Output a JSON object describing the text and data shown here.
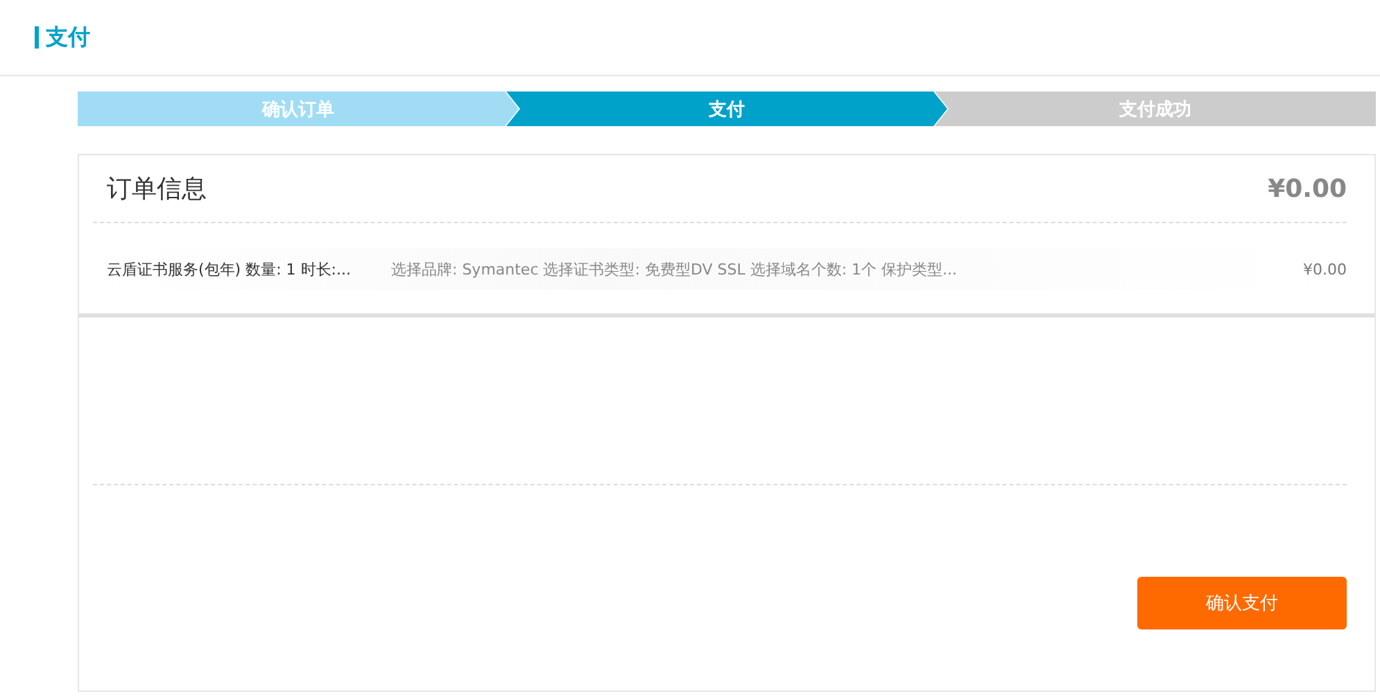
{
  "header": {
    "title": "支付"
  },
  "steps": [
    {
      "label": "确认订单",
      "kind": "done"
    },
    {
      "label": "支付",
      "kind": "current"
    },
    {
      "label": "支付成功",
      "kind": "todo"
    }
  ],
  "order": {
    "title": "订单信息",
    "total": "¥0.00",
    "items": [
      {
        "name": "云盾证书服务(包年) 数量: 1 时长:...",
        "detail": "选择品牌: Symantec 选择证书类型: 免费型DV SSL 选择域名个数: 1个 保护类型...",
        "price": "¥0.00"
      }
    ]
  },
  "confirm_button": "确认支付"
}
